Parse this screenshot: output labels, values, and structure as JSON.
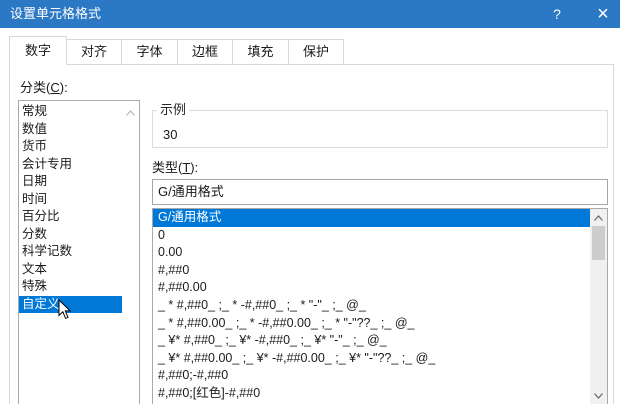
{
  "window": {
    "title": "设置单元格格式",
    "help_label": "?",
    "close_label": "×"
  },
  "tabs": [
    {
      "label": "数字",
      "active": true
    },
    {
      "label": "对齐",
      "active": false
    },
    {
      "label": "字体",
      "active": false
    },
    {
      "label": "边框",
      "active": false
    },
    {
      "label": "填充",
      "active": false
    },
    {
      "label": "保护",
      "active": false
    }
  ],
  "category": {
    "label_prefix": "分类(",
    "label_key": "C",
    "label_suffix": "):",
    "items": [
      {
        "text": "常规"
      },
      {
        "text": "数值"
      },
      {
        "text": "货币"
      },
      {
        "text": "会计专用"
      },
      {
        "text": "日期"
      },
      {
        "text": "时间"
      },
      {
        "text": "百分比"
      },
      {
        "text": "分数"
      },
      {
        "text": "科学记数"
      },
      {
        "text": "文本"
      },
      {
        "text": "特殊"
      },
      {
        "text": "自定义",
        "selected": true
      }
    ]
  },
  "sample": {
    "label": "示例",
    "value": "30"
  },
  "format_type": {
    "label_prefix": "类型(",
    "label_key": "T",
    "label_suffix": "):",
    "value": "G/通用格式",
    "items": [
      {
        "text": "G/通用格式",
        "selected": true
      },
      {
        "text": "0"
      },
      {
        "text": "0.00"
      },
      {
        "text": "#,##0"
      },
      {
        "text": "#,##0.00"
      },
      {
        "text": "_ * #,##0_ ;_ * -#,##0_ ;_ * \"-\"_ ;_ @_"
      },
      {
        "text": "_ * #,##0.00_ ;_ * -#,##0.00_ ;_ * \"-\"??_ ;_ @_"
      },
      {
        "text": "_ ¥* #,##0_ ;_ ¥* -#,##0_ ;_ ¥* \"-\"_ ;_ @_"
      },
      {
        "text": "_ ¥* #,##0.00_ ;_ ¥* -#,##0.00_ ;_ ¥* \"-\"??_ ;_ @_"
      },
      {
        "text": "#,##0;-#,##0"
      },
      {
        "text": "#,##0;[红色]-#,##0"
      }
    ],
    "scrollbar": {
      "position": 0,
      "visible_fraction": 0.21
    }
  },
  "colors": {
    "title_bar": "#2b78c5",
    "title_text": "#ffffff",
    "selection": "#0078d7",
    "selection_text": "#ffffff"
  },
  "icons": {
    "help": "help-icon",
    "close": "close-icon",
    "scroll_up": "chevron-up-icon",
    "scroll_down": "chevron-down-icon",
    "pointer": "mouse-pointer-icon"
  }
}
